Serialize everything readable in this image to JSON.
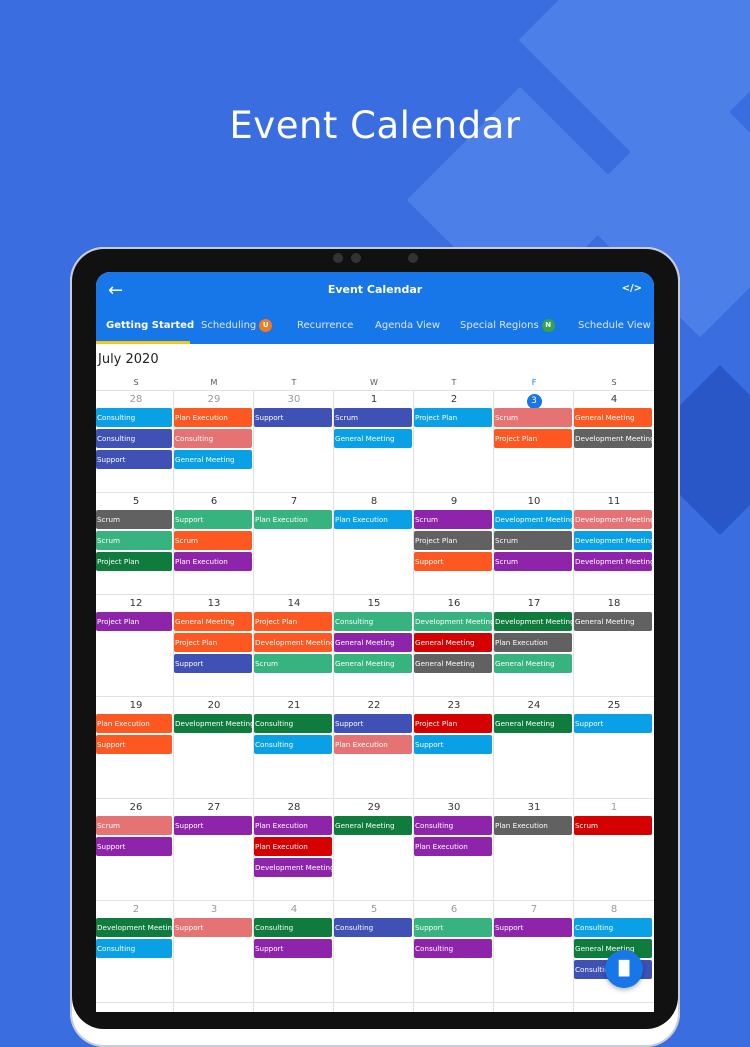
{
  "hero_title": "Event Calendar",
  "app": {
    "title": "Event Calendar",
    "back_icon": "←",
    "code_icon": "</>",
    "tabs": [
      {
        "label": "Getting Started",
        "active": true
      },
      {
        "label": "Scheduling",
        "badge": "U",
        "badge_color": "#f07c1e"
      },
      {
        "label": "Recurrence"
      },
      {
        "label": "Agenda View"
      },
      {
        "label": "Special Regions",
        "badge": "N",
        "badge_color": "#3aa34a"
      },
      {
        "label": "Schedule View"
      }
    ]
  },
  "calendar": {
    "month_label": "July 2020",
    "weekdays": [
      "S",
      "M",
      "T",
      "W",
      "T",
      "F",
      "S"
    ],
    "highlight_weekday": 5,
    "today_index": 5,
    "days": [
      "28",
      "29",
      "30",
      "1",
      "2",
      "3",
      "4",
      "5",
      "6",
      "7",
      "8",
      "9",
      "10",
      "11",
      "12",
      "13",
      "14",
      "15",
      "16",
      "17",
      "18",
      "19",
      "20",
      "21",
      "22",
      "23",
      "24",
      "25",
      "26",
      "27",
      "28",
      "29",
      "30",
      "31",
      "1",
      "2",
      "3",
      "4",
      "5",
      "6",
      "7",
      "8"
    ],
    "dim_days": [
      0,
      1,
      2,
      34,
      35,
      36,
      37,
      38,
      39,
      40,
      41
    ],
    "events": [
      [
        [
          "Consulting",
          "#0aa0e6"
        ],
        [
          "Consulting",
          "#3f51b5"
        ],
        [
          "Support",
          "#3f51b5"
        ]
      ],
      [
        [
          "Plan Execution",
          "#fd5722"
        ],
        [
          "Consulting",
          "#e57373"
        ],
        [
          "General Meeting",
          "#0aa0e6"
        ]
      ],
      [
        [
          "Support",
          "#3f51b5"
        ]
      ],
      [
        [
          "Scrum",
          "#3f51b5"
        ],
        [
          "General Meeting",
          "#0aa0e6"
        ]
      ],
      [
        [
          "Project Plan",
          "#0aa0e6"
        ]
      ],
      [
        [
          "Scrum",
          "#e57373"
        ],
        [
          "Project Plan",
          "#fd5722"
        ]
      ],
      [
        [
          "General Meeting",
          "#fd5722"
        ],
        [
          "Development Meeting",
          "#616161"
        ]
      ],
      [
        [
          "Scrum",
          "#616161"
        ],
        [
          "Scrum",
          "#36b37e"
        ],
        [
          "Project Plan",
          "#0f7b3c"
        ]
      ],
      [
        [
          "Support",
          "#36b37e"
        ],
        [
          "Scrum",
          "#fd5722"
        ],
        [
          "Plan Execution",
          "#8e24aa"
        ]
      ],
      [
        [
          "Plan Execution",
          "#36b37e"
        ]
      ],
      [
        [
          "Plan Execution",
          "#0aa0e6"
        ]
      ],
      [
        [
          "Scrum",
          "#8e24aa"
        ],
        [
          "Project Plan",
          "#616161"
        ],
        [
          "Support",
          "#fd5722"
        ]
      ],
      [
        [
          "Development Meeting",
          "#0aa0e6"
        ],
        [
          "Scrum",
          "#616161"
        ],
        [
          "Scrum",
          "#8e24aa"
        ]
      ],
      [
        [
          "Development Meeting",
          "#e57373"
        ],
        [
          "Development Meeting",
          "#0aa0e6"
        ],
        [
          "Development Meeting",
          "#8e24aa"
        ]
      ],
      [
        [
          "Project Plan",
          "#8e24aa"
        ]
      ],
      [
        [
          "General Meeting",
          "#fd5722"
        ],
        [
          "Project Plan",
          "#fd5722"
        ],
        [
          "Support",
          "#3f51b5"
        ]
      ],
      [
        [
          "Project Plan",
          "#fd5722"
        ],
        [
          "Development Meeting",
          "#fd5722"
        ],
        [
          "Scrum",
          "#36b37e"
        ]
      ],
      [
        [
          "Consulting",
          "#36b37e"
        ],
        [
          "General Meeting",
          "#8e24aa"
        ],
        [
          "General Meeting",
          "#36b37e"
        ]
      ],
      [
        [
          "Development Meeting",
          "#36b37e"
        ],
        [
          "General Meeting",
          "#d50000"
        ],
        [
          "General Meeting",
          "#616161"
        ]
      ],
      [
        [
          "Development Meeting",
          "#0f7b3c"
        ],
        [
          "Plan Execution",
          "#616161"
        ],
        [
          "General Meeting",
          "#36b37e"
        ]
      ],
      [
        [
          "General Meeting",
          "#616161"
        ]
      ],
      [
        [
          "Plan Execution",
          "#fd5722"
        ],
        [
          "Support",
          "#fd5722"
        ]
      ],
      [
        [
          "Development Meeting",
          "#0f7b3c"
        ]
      ],
      [
        [
          "Consulting",
          "#0f7b3c"
        ],
        [
          "Consulting",
          "#0aa0e6"
        ]
      ],
      [
        [
          "Support",
          "#3f51b5"
        ],
        [
          "Plan Execution",
          "#e57373"
        ]
      ],
      [
        [
          "Project Plan",
          "#d50000"
        ],
        [
          "Support",
          "#0aa0e6"
        ]
      ],
      [
        [
          "General Meeting",
          "#0f7b3c"
        ]
      ],
      [
        [
          "Support",
          "#0aa0e6"
        ]
      ],
      [
        [
          "Scrum",
          "#e57373"
        ],
        [
          "Support",
          "#8e24aa"
        ]
      ],
      [
        [
          "Support",
          "#8e24aa"
        ]
      ],
      [
        [
          "Plan Execution",
          "#8e24aa"
        ],
        [
          "Plan Execution",
          "#d50000"
        ],
        [
          "Development Meeting",
          "#8e24aa"
        ]
      ],
      [
        [
          "General Meeting",
          "#0f7b3c"
        ]
      ],
      [
        [
          "Consulting",
          "#8e24aa"
        ],
        [
          "Plan Execution",
          "#8e24aa"
        ]
      ],
      [
        [
          "Plan Execution",
          "#616161"
        ]
      ],
      [
        [
          "Scrum",
          "#d50000"
        ]
      ],
      [
        [
          "Development Meeting",
          "#0f7b3c"
        ],
        [
          "Consulting",
          "#0aa0e6"
        ]
      ],
      [
        [
          "Support",
          "#e57373"
        ]
      ],
      [
        [
          "Consulting",
          "#0f7b3c"
        ],
        [
          "Support",
          "#8e24aa"
        ]
      ],
      [
        [
          "Consulting",
          "#3f51b5"
        ]
      ],
      [
        [
          "Support",
          "#36b37e"
        ],
        [
          "Consulting",
          "#8e24aa"
        ]
      ],
      [
        [
          "Support",
          "#8e24aa"
        ]
      ],
      [
        [
          "Consulting",
          "#0aa0e6"
        ],
        [
          "General Meeting",
          "#0f7b3c"
        ],
        [
          "Consulting",
          "#3f51b5"
        ]
      ]
    ]
  },
  "fab_icon": "waveform-icon"
}
